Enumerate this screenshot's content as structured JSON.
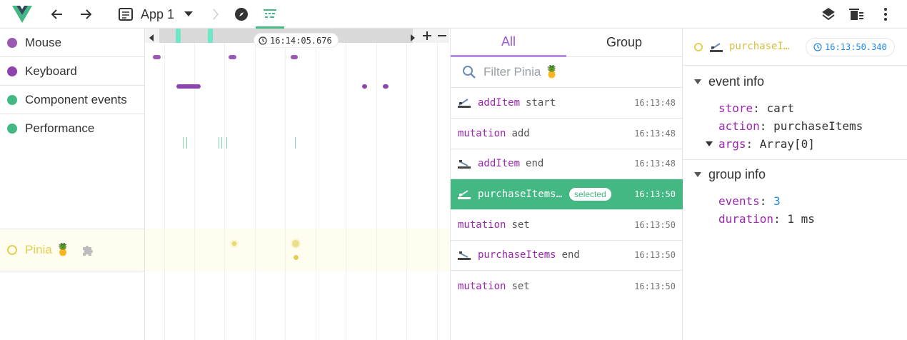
{
  "toolbar": {
    "app_name": "App 1",
    "icons": [
      "vue-logo",
      "back-arrow",
      "forward-arrow",
      "app-icon",
      "dropdown",
      "breadcrumb-chevron",
      "explore-compass",
      "timeline-icon",
      "layers",
      "clear-all",
      "more-vert"
    ]
  },
  "layers": [
    {
      "label": "Mouse",
      "color": "#9b59b6"
    },
    {
      "label": "Keyboard",
      "color": "#8e44ad"
    },
    {
      "label": "Component events",
      "color": "#42b883"
    },
    {
      "label": "Performance",
      "color": "#42b883"
    },
    {
      "label": "Pinia 🍍",
      "color": "#e2cf55"
    }
  ],
  "timeline": {
    "cursor_time": "16:14:05.676"
  },
  "tabs": {
    "all": "All",
    "group": "Group"
  },
  "filter": {
    "placeholder": "Filter Pinia 🍍"
  },
  "events": [
    {
      "name": "addItem",
      "sub": "start",
      "time": "16:13:48",
      "icon": "start-flag"
    },
    {
      "name": "mutation",
      "sub": "add",
      "time": "16:13:48",
      "icon": ""
    },
    {
      "name": "addItem",
      "sub": "end",
      "time": "16:13:48",
      "icon": "end-flag"
    },
    {
      "name": "purchaseItems…",
      "sub": "",
      "time": "16:13:50",
      "icon": "start-flag",
      "badge": "selected"
    },
    {
      "name": "mutation",
      "sub": "set",
      "time": "16:13:50",
      "icon": ""
    },
    {
      "name": "purchaseItems",
      "sub": "end",
      "time": "16:13:50",
      "icon": "end-flag"
    },
    {
      "name": "mutation",
      "sub": "set",
      "time": "16:13:50",
      "icon": ""
    }
  ],
  "inspector": {
    "title": "purchaseI…",
    "time": "16:13:50.340",
    "event_info": {
      "title": "event info",
      "store_key": "store",
      "store_val": "cart",
      "action_key": "action",
      "action_val": "purchaseItems",
      "args_key": "args",
      "args_val": "Array[0]"
    },
    "group_info": {
      "title": "group info",
      "events_key": "events",
      "events_val": "3",
      "duration_key": "duration",
      "duration_val": "1 ms"
    }
  }
}
